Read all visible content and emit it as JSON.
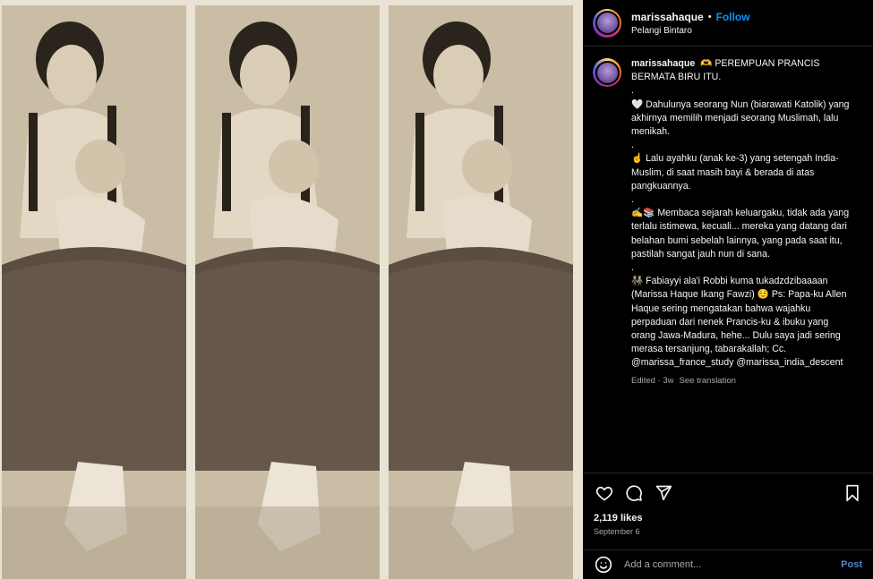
{
  "post": {
    "username": "marissahaque",
    "separator": "•",
    "follow_label": "Follow",
    "location": "Pelangi Bintaro"
  },
  "caption": {
    "username": "marissahaque",
    "lines": [
      "🫶 PEREMPUAN PRANCIS BERMATA BIRU ITU.",
      ".",
      "🤍 Dahulunya seorang Nun (biarawati Katolik) yang akhirnya memilih menjadi seorang Muslimah, lalu menikah.",
      ".",
      "☝️ Lalu ayahku (anak ke-3) yang setengah India-Muslim, di saat masih bayi & berada di atas pangkuannya.",
      ".",
      "✍️📚 Membaca sejarah keluargaku, tidak ada yang terlalu istimewa, kecuali... mereka yang datang dari belahan bumi sebelah lainnya, yang pada saat itu, pastilah sangat jauh nun di sana.",
      ".",
      "👫 Fabiayyi ala'i Robbi kuma tukadzdzibaaaan (Marissa Haque Ikang Fawzi) ☺️ Ps: Papa-ku Allen Haque sering mengatakan bahwa wajahku perpaduan dari nenek Prancis-ku & ibuku yang orang Jawa-Madura, hehe... Dulu saya jadi sering merasa tersanjung, tabarakallah; Cc. @marissa_france_study @marissa_india_descent"
    ],
    "edited": "Edited · 3w",
    "see_translation": "See translation"
  },
  "actions": {
    "like_icon": "heart-icon",
    "comment_icon": "comment-icon",
    "share_icon": "share-icon",
    "save_icon": "bookmark-icon"
  },
  "likes": "2,119 likes",
  "date": "September 6",
  "comment": {
    "placeholder": "Add a comment...",
    "post_label": "Post"
  },
  "colors": {
    "background": "#000000",
    "follow": "#0095f6",
    "post": "#4b87c6",
    "muted": "#a8a8a8",
    "photo_sepia": "#bfb39b"
  }
}
